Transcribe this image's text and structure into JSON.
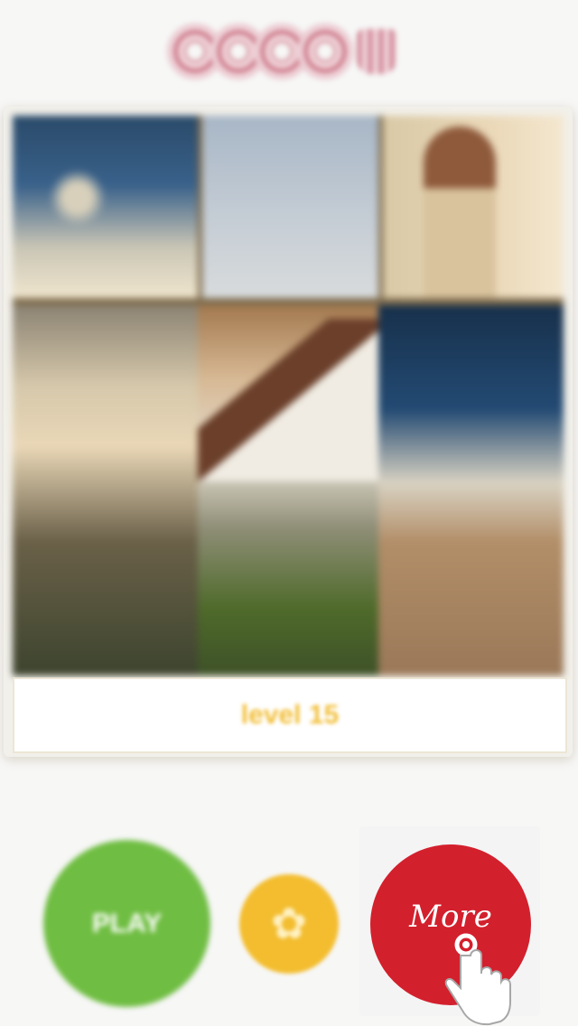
{
  "logo": {
    "name": "logo-icon"
  },
  "puzzle": {
    "caption": "level 15"
  },
  "controls": {
    "left_button_label": "PLAY",
    "settings_icon": "gear-icon",
    "more_label": "More",
    "tap_icon": "tap-hand-icon"
  },
  "colors": {
    "green": "#6fbd42",
    "yellow": "#f3bd2f",
    "red": "#d3202d",
    "caption": "#f2bf3a"
  }
}
